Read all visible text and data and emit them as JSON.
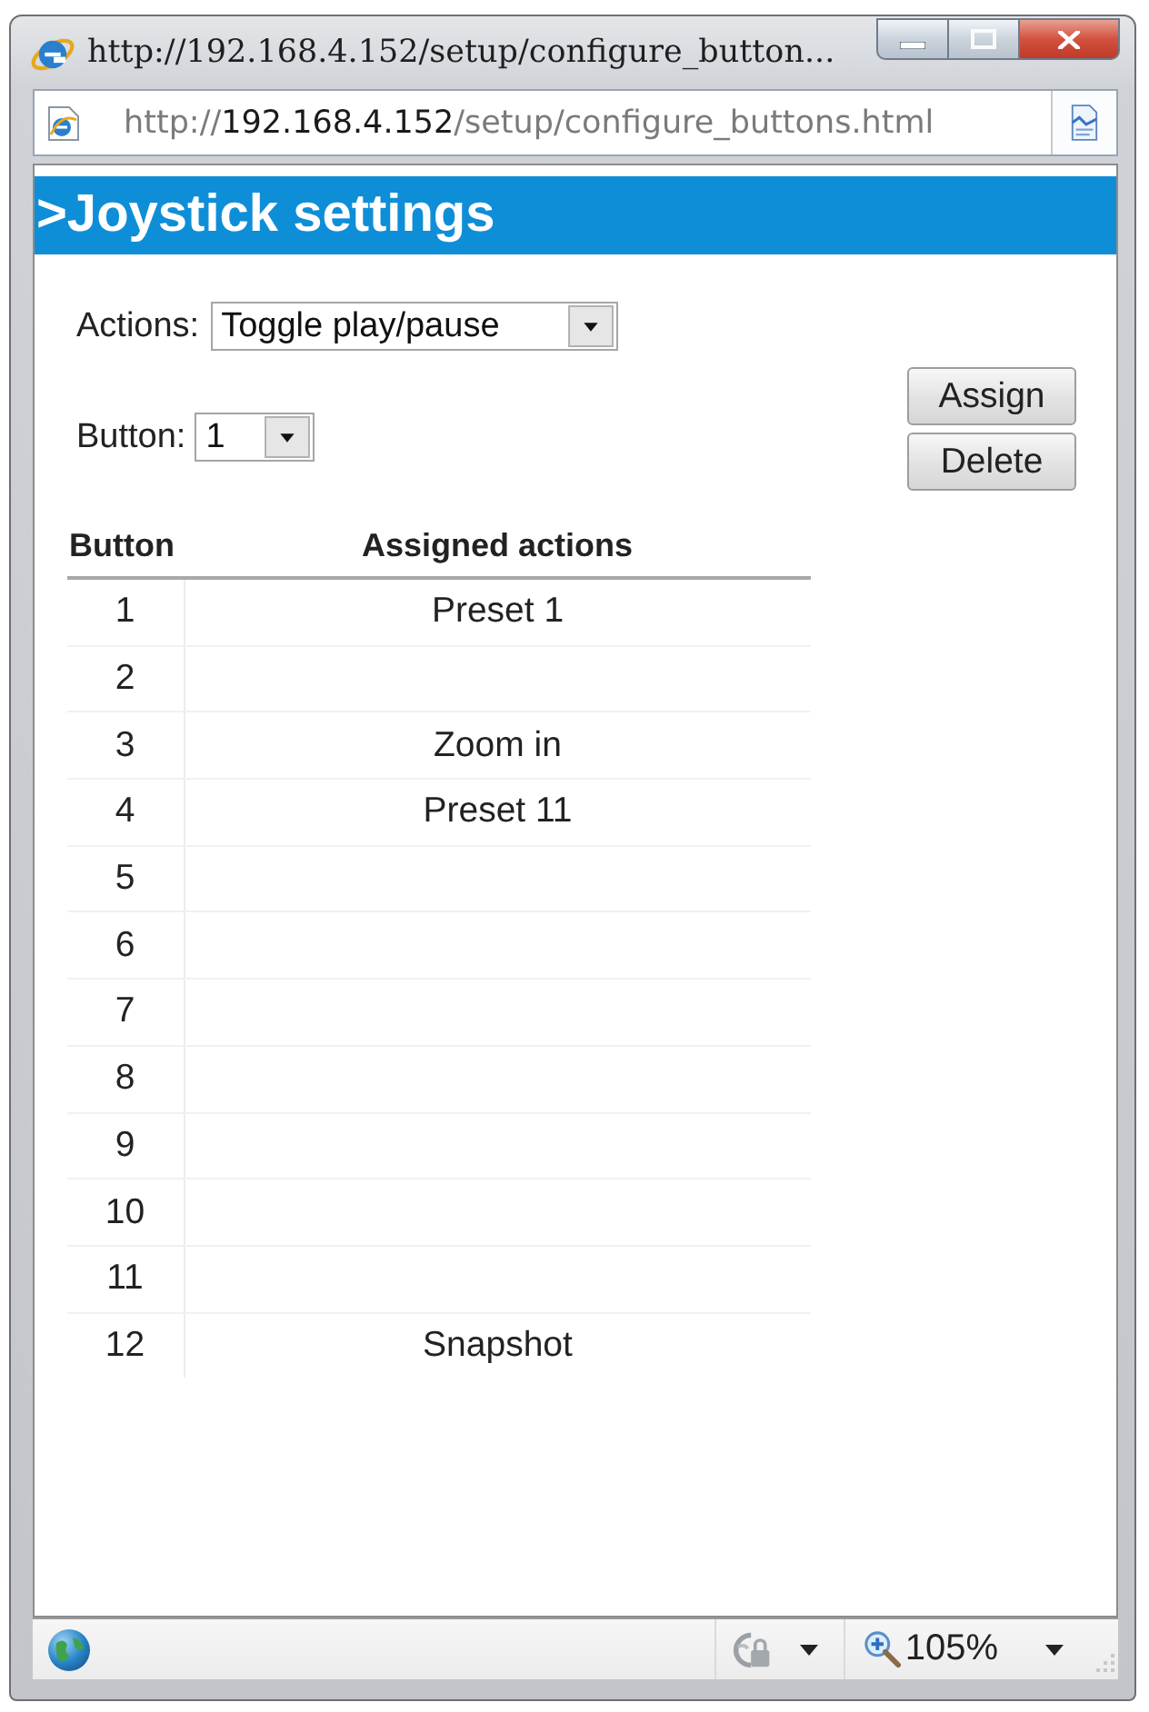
{
  "window": {
    "title": "http://192.168.4.152/setup/configure_button..."
  },
  "address_bar": {
    "url": "http://**192.168.4.152**/setup/configure_buttons.html"
  },
  "page": {
    "heading": ">Joystick settings",
    "actions_label": "Actions:",
    "actions_select": {
      "value": "Toggle play/pause"
    },
    "button_label": "Button:",
    "button_select": {
      "value": "1"
    },
    "buttons": [
      "Assign",
      "Delete"
    ]
  },
  "table": {
    "columns": [
      "Button",
      "Assigned actions"
    ],
    "rows": [
      {
        "button": "1",
        "action": "Preset 1"
      },
      {
        "button": "2"
      },
      {
        "button": "3",
        "action": "Zoom in"
      },
      {
        "button": "4",
        "action": "Preset 11"
      },
      {
        "button": "5"
      },
      {
        "button": "6"
      },
      {
        "button": "7"
      },
      {
        "button": "8"
      },
      {
        "button": "9"
      },
      {
        "button": "10"
      },
      {
        "button": "11"
      },
      {
        "button": "12",
        "action": "Snapshot"
      }
    ]
  },
  "status_bar": {
    "zoom": "105%"
  }
}
